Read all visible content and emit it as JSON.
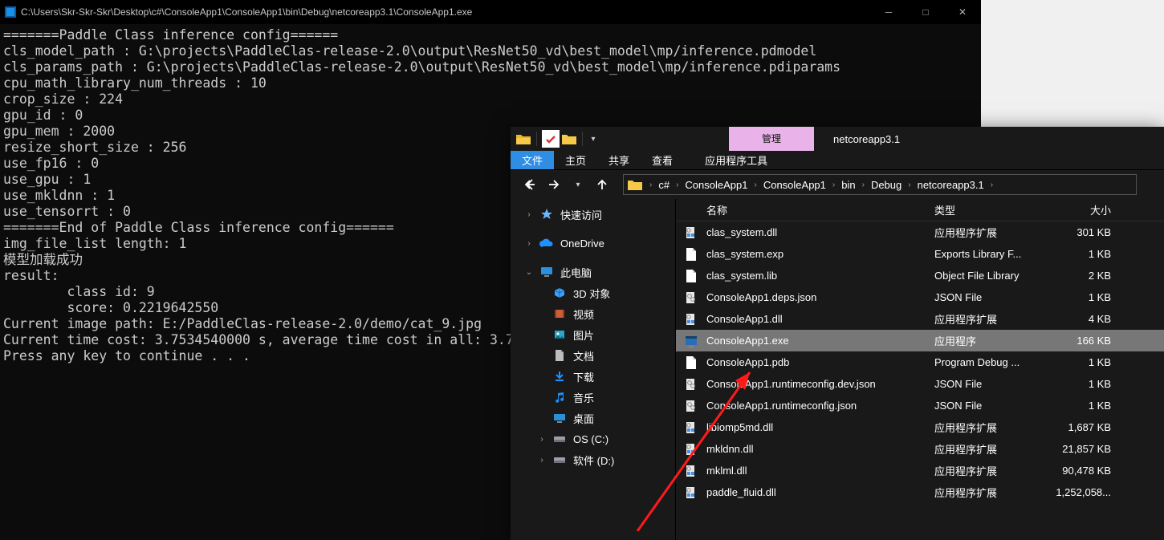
{
  "console": {
    "title": "C:\\Users\\Skr-Skr-Skr\\Desktop\\c#\\ConsoleApp1\\ConsoleApp1\\bin\\Debug\\netcoreapp3.1\\ConsoleApp1.exe",
    "lines": [
      "=======Paddle Class inference config======",
      "cls_model_path : G:\\projects\\PaddleClas-release-2.0\\output\\ResNet50_vd\\best_model\\mp/inference.pdmodel",
      "cls_params_path : G:\\projects\\PaddleClas-release-2.0\\output\\ResNet50_vd\\best_model\\mp/inference.pdiparams",
      "cpu_math_library_num_threads : 10",
      "crop_size : 224",
      "gpu_id : 0",
      "gpu_mem : 2000",
      "resize_short_size : 256",
      "use_fp16 : 0",
      "use_gpu : 1",
      "use_mkldnn : 1",
      "use_tensorrt : 0",
      "=======End of Paddle Class inference config======",
      "img_file_list length: 1",
      "模型加载成功",
      "result:",
      "        class id: 9",
      "        score: 0.2219642550",
      "Current image path: E:/PaddleClas-release-2.0/demo/cat_9.jpg",
      "Current time cost: 3.7534540000 s, average time cost in all: 3.7",
      "Press any key to continue . . ."
    ]
  },
  "explorer": {
    "ribbon_context_label": "管理",
    "window_title": "netcoreapp3.1",
    "tabs": {
      "file": "文件",
      "home": "主页",
      "share": "共享",
      "view": "查看",
      "context": "应用程序工具"
    },
    "breadcrumb": [
      "c#",
      "ConsoleApp1",
      "ConsoleApp1",
      "bin",
      "Debug",
      "netcoreapp3.1"
    ],
    "nav_pane": {
      "quick_access": "快速访问",
      "onedrive": "OneDrive",
      "this_pc": "此电脑",
      "objects_3d": "3D 对象",
      "videos": "视频",
      "pictures": "图片",
      "documents": "文档",
      "downloads": "下载",
      "music": "音乐",
      "desktop": "桌面",
      "os_c": "OS (C:)",
      "soft_d": "软件 (D:)"
    },
    "columns": {
      "name": "名称",
      "type": "类型",
      "size": "大小"
    },
    "files": [
      {
        "name": "clas_system.dll",
        "type": "应用程序扩展",
        "size": "301 KB",
        "icon": "dll",
        "selected": false
      },
      {
        "name": "clas_system.exp",
        "type": "Exports Library F...",
        "size": "1 KB",
        "icon": "file",
        "selected": false
      },
      {
        "name": "clas_system.lib",
        "type": "Object File Library",
        "size": "2 KB",
        "icon": "file",
        "selected": false
      },
      {
        "name": "ConsoleApp1.deps.json",
        "type": "JSON File",
        "size": "1 KB",
        "icon": "json",
        "selected": false
      },
      {
        "name": "ConsoleApp1.dll",
        "type": "应用程序扩展",
        "size": "4 KB",
        "icon": "dll",
        "selected": false
      },
      {
        "name": "ConsoleApp1.exe",
        "type": "应用程序",
        "size": "166 KB",
        "icon": "exe",
        "selected": true
      },
      {
        "name": "ConsoleApp1.pdb",
        "type": "Program Debug ...",
        "size": "1 KB",
        "icon": "file",
        "selected": false
      },
      {
        "name": "ConsoleApp1.runtimeconfig.dev.json",
        "type": "JSON File",
        "size": "1 KB",
        "icon": "json",
        "selected": false
      },
      {
        "name": "ConsoleApp1.runtimeconfig.json",
        "type": "JSON File",
        "size": "1 KB",
        "icon": "json",
        "selected": false
      },
      {
        "name": "libiomp5md.dll",
        "type": "应用程序扩展",
        "size": "1,687 KB",
        "icon": "dll",
        "selected": false
      },
      {
        "name": "mkldnn.dll",
        "type": "应用程序扩展",
        "size": "21,857 KB",
        "icon": "dll",
        "selected": false
      },
      {
        "name": "mklml.dll",
        "type": "应用程序扩展",
        "size": "90,478 KB",
        "icon": "dll",
        "selected": false
      },
      {
        "name": "paddle_fluid.dll",
        "type": "应用程序扩展",
        "size": "1,252,058...",
        "icon": "dll",
        "selected": false
      }
    ]
  }
}
